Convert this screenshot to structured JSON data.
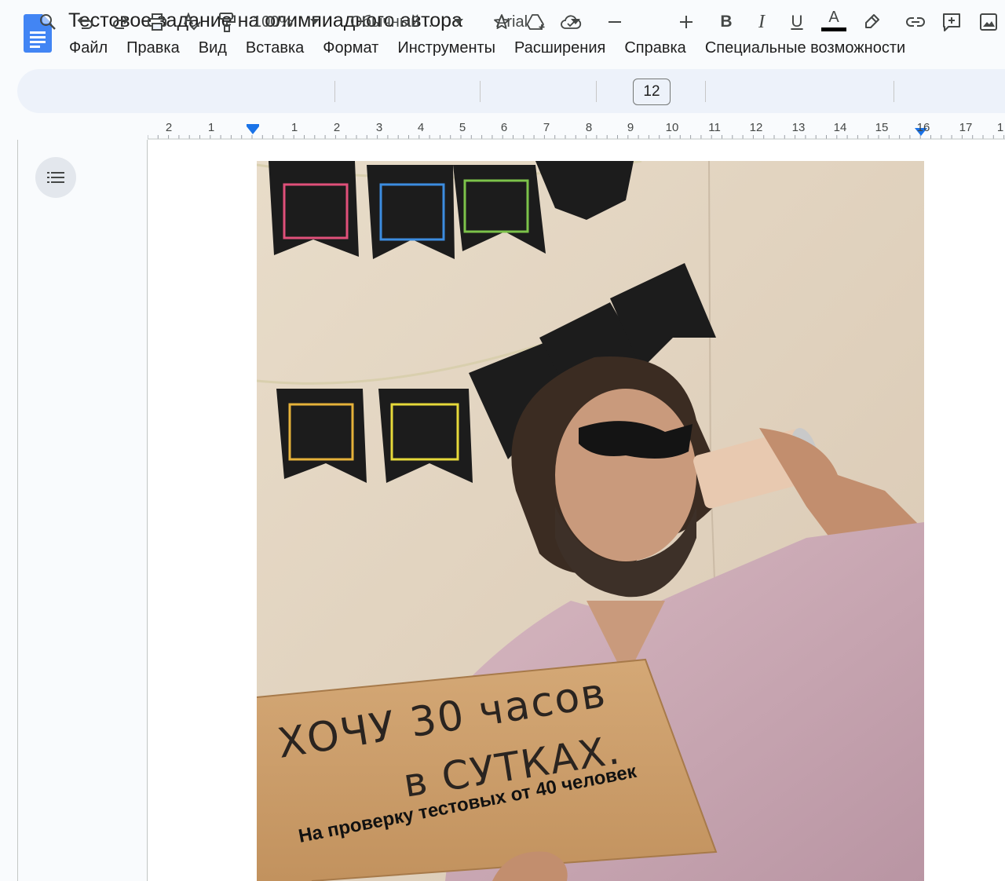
{
  "app": {
    "title": "Тестовое задание на олимпиадного автора"
  },
  "title_icons": [
    "star-icon",
    "move-to-drive-icon",
    "cloud-status-icon"
  ],
  "menu": [
    "Файл",
    "Правка",
    "Вид",
    "Вставка",
    "Формат",
    "Инструменты",
    "Расширения",
    "Справка",
    "Специальные возможности"
  ],
  "toolbar": {
    "zoom": "100%",
    "style": "Обычный ...",
    "font": "Arial",
    "font_size": "12",
    "bold_label": "B",
    "italic_label": "I",
    "underline_label": "U",
    "text_color_label": "A"
  },
  "ruler": {
    "labels": [
      "2",
      "1",
      "1",
      "2",
      "3",
      "4",
      "5",
      "6",
      "7",
      "8",
      "9",
      "10",
      "11",
      "12",
      "13",
      "14",
      "15",
      "16",
      "17",
      "1"
    ]
  },
  "image": {
    "sign_line1": "ХОЧУ 30 часов",
    "sign_line2": "в СУТКАХ.",
    "sign_caption": "На проверку тестовых от 40 человек"
  },
  "colors": {
    "accent": "#0b57d0",
    "toolbar_bg": "#edf2fa",
    "doc_icon": "#4285f4"
  }
}
